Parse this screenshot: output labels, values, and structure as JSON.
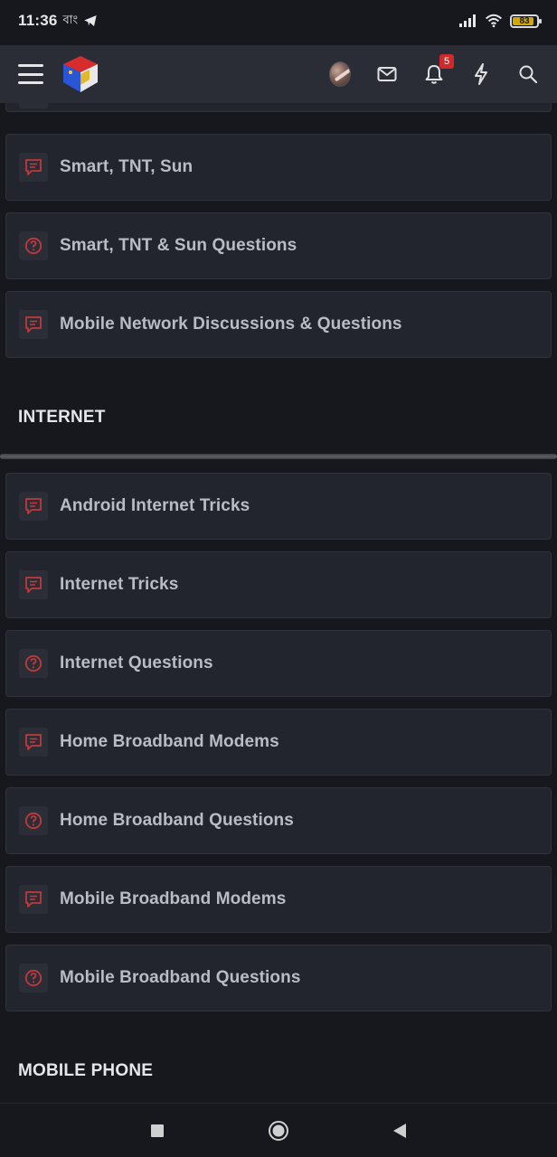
{
  "status_bar": {
    "time": "11:36",
    "battery_level": "83",
    "icons": [
      "bn-icon",
      "telegram-icon",
      "signal-icon",
      "wifi-icon",
      "battery-icon"
    ]
  },
  "header": {
    "icons": [
      "menu-icon",
      "site-logo",
      "avatar",
      "mail-icon",
      "bell-icon",
      "lightning-icon",
      "search-icon"
    ],
    "notification_count": "5"
  },
  "forums_top": [
    {
      "label": "Smart, TNT, Sun",
      "icon": "discussion-icon"
    },
    {
      "label": "Smart, TNT & Sun Questions",
      "icon": "question-icon"
    },
    {
      "label": "Mobile Network Discussions & Questions",
      "icon": "discussion-icon"
    }
  ],
  "sections": {
    "internet": "INTERNET",
    "mobile_phone": "MOBILE PHONE"
  },
  "forums_internet": [
    {
      "label": "Android Internet Tricks",
      "icon": "discussion-icon"
    },
    {
      "label": "Internet Tricks",
      "icon": "discussion-icon"
    },
    {
      "label": "Internet Questions",
      "icon": "question-icon"
    },
    {
      "label": "Home Broadband Modems",
      "icon": "discussion-icon"
    },
    {
      "label": "Home Broadband Questions",
      "icon": "question-icon"
    },
    {
      "label": "Mobile Broadband Modems",
      "icon": "discussion-icon"
    },
    {
      "label": "Mobile Broadband Questions",
      "icon": "question-icon"
    }
  ],
  "colors": {
    "background": "#16181d",
    "header": "#2a2d36",
    "card": "#22252d",
    "icon_accent": "#c0393b",
    "badge": "#d0292c"
  }
}
